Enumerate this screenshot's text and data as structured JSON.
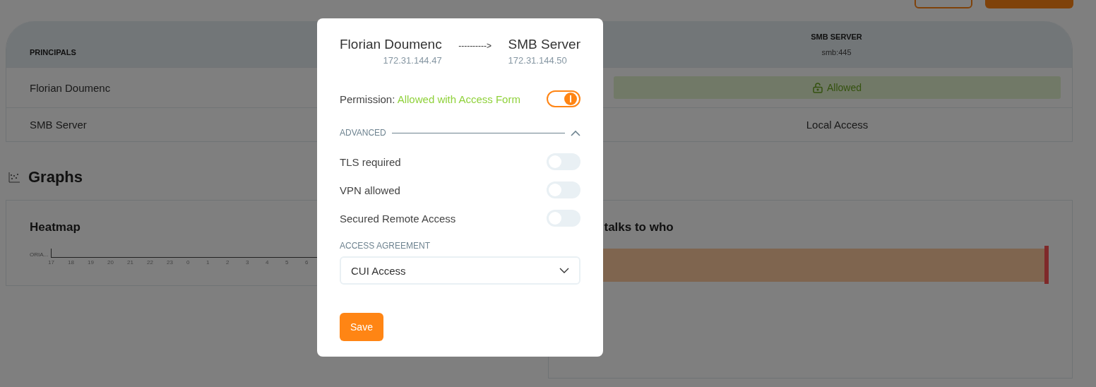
{
  "matrix": {
    "columns": [
      {
        "title": "PRINCIPALS"
      },
      {
        "title": "SMB SERVER",
        "subtitle": "smb:445"
      }
    ],
    "rows": [
      {
        "principal": "Florian Doumenc",
        "cell": {
          "kind": "badge",
          "text": "Allowed"
        }
      },
      {
        "principal": "SMB Server",
        "cell": {
          "kind": "text",
          "text": "Local Access"
        }
      }
    ]
  },
  "graphs": {
    "title": "Graphs",
    "heatmap": {
      "title": "Heatmap",
      "row_label": "ORIA...",
      "hours": [
        "17",
        "18",
        "19",
        "20",
        "21",
        "22",
        "23",
        "0",
        "1",
        "2",
        "3",
        "4",
        "5",
        "6"
      ]
    },
    "flows": {
      "title": "talks to who"
    }
  },
  "dialog": {
    "source": {
      "name": "Florian Doumenc",
      "ip": "172.31.144.47"
    },
    "arrow": "---------->",
    "target": {
      "name": "SMB Server",
      "ip": "172.31.144.50"
    },
    "permission": {
      "label": "Permission:",
      "value": "Allowed with Access Form",
      "on": true
    },
    "advanced": {
      "label": "ADVANCED",
      "expanded": true,
      "options": [
        {
          "label": "TLS required",
          "on": false
        },
        {
          "label": "VPN allowed",
          "on": false
        },
        {
          "label": "Secured Remote Access",
          "on": false
        }
      ]
    },
    "access_agreement": {
      "label": "ACCESS AGREEMENT",
      "value": "CUI Access"
    },
    "save": "Save"
  }
}
